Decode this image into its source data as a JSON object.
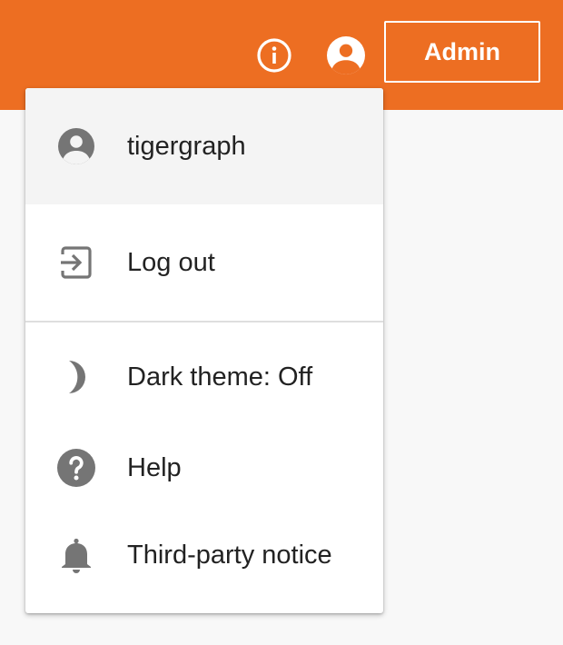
{
  "header": {
    "info_icon": "info-circle-icon",
    "account_icon": "account-circle-icon",
    "admin_label": "Admin",
    "accent_color": "#ed6e22"
  },
  "menu": {
    "user": {
      "icon": "account-circle-icon",
      "label": "tigergraph"
    },
    "logout": {
      "icon": "exit-to-app-icon",
      "label": "Log out"
    },
    "dark_theme": {
      "icon": "moon-icon",
      "label": "Dark theme: Off"
    },
    "help": {
      "icon": "help-circle-icon",
      "label": "Help"
    },
    "notice": {
      "icon": "bell-icon",
      "label": "Third-party notice"
    }
  }
}
